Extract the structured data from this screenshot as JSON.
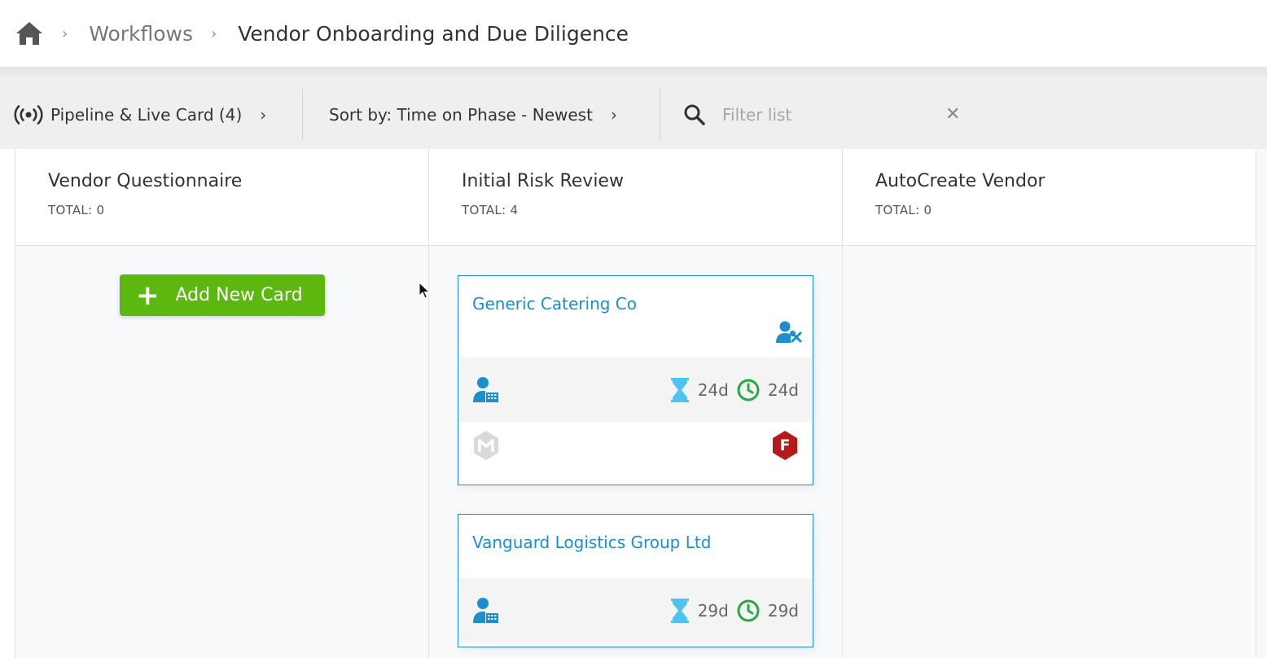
{
  "breadcrumb": {
    "home_icon": "home-icon",
    "sep": "›",
    "workflows": "Workflows",
    "current": "Vendor Onboarding and Due Diligence"
  },
  "toolbar": {
    "pipeline_label": "Pipeline & Live Card (4)",
    "sort_label": "Sort by: Time on Phase - Newest",
    "chevron": "›",
    "filter_placeholder": "Filter list",
    "clear": "✕"
  },
  "columns": [
    {
      "title": "Vendor Questionnaire",
      "total": "TOTAL: 0",
      "add_button": "Add New Card"
    },
    {
      "title": "Initial Risk Review",
      "total": "TOTAL: 4"
    },
    {
      "title": "AutoCreate Vendor",
      "total": "TOTAL: 0"
    }
  ],
  "cards": [
    {
      "title": "Generic Catering Co",
      "phase_time": "24d",
      "total_time": "24d",
      "badge_letter": "F"
    },
    {
      "title": "Vanguard Logistics Group Ltd",
      "phase_time": "29d",
      "total_time": "29d"
    }
  ],
  "colors": {
    "accent_blue": "#1b8fce",
    "green_button": "#5cb80f",
    "clock_green": "#27a845",
    "badge_red": "#b51a1a",
    "hourglass_blue": "#4fc3f0"
  }
}
